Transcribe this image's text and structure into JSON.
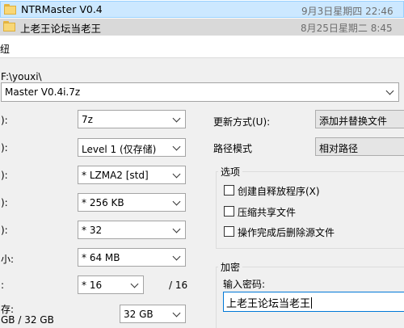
{
  "files": [
    {
      "name": "NTRMaster V0.4",
      "date": "9月3日星期四 22:46"
    },
    {
      "name": "上老王论坛当老王",
      "date": "8月25日星期二 8:45"
    }
  ],
  "dialog": {
    "header_fragment": "纽",
    "path": "F:\\youxi\\",
    "archive_name": "Master V0.4i.7z",
    "rows": [
      {
        "label": "):",
        "value": "7z"
      },
      {
        "label": "):",
        "value": "Level 1 (仅存储)"
      },
      {
        "label": "):",
        "value": "* LZMA2 [std]"
      },
      {
        "label": "):",
        "value": "* 256 KB"
      },
      {
        "label": "):",
        "value": "* 32"
      },
      {
        "label": "小:",
        "value": "* 64 MB"
      },
      {
        "label": ":",
        "value": "* 16",
        "suffix": "/ 16"
      }
    ],
    "memory": {
      "label1": "存:",
      "label2": "GB / 32 GB",
      "value": "32 GB"
    },
    "update_mode": {
      "label": "更新方式(U):",
      "value": "添加并替换文件"
    },
    "path_mode": {
      "label": "路径模式",
      "value": "相对路径"
    },
    "options": {
      "title": "选项",
      "items": [
        {
          "label": "创建自释放程序(X)",
          "checked": false
        },
        {
          "label": "压缩共享文件",
          "checked": false
        },
        {
          "label": "操作完成后删除源文件",
          "checked": false
        }
      ]
    },
    "encryption": {
      "title": "加密",
      "password_label": "输入密码:",
      "password_value": "上老王论坛当老王"
    }
  }
}
